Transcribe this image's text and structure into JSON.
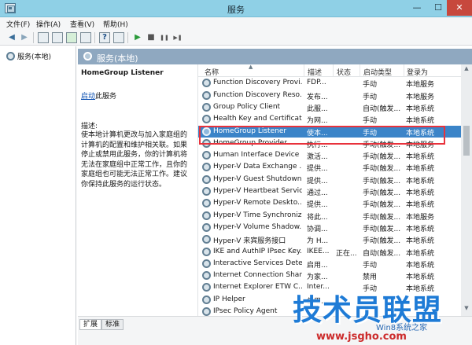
{
  "window": {
    "title": "服务",
    "min": "—",
    "max": "☐",
    "close": "✕"
  },
  "menu": [
    "文件(F)",
    "操作(A)",
    "查看(V)",
    "帮助(H)"
  ],
  "toolbar": {
    "back": "◀",
    "forward": "▶",
    "help": "?",
    "play": "▶",
    "stop": "■",
    "pause": "❚❚",
    "restart": "▶❚"
  },
  "tree": {
    "root_label": "服务(本地)"
  },
  "main": {
    "header_label": "服务(本地)"
  },
  "description": {
    "service_name": "HomeGroup Listener",
    "start_link": "启动",
    "start_suffix": "此服务",
    "heading": "描述:",
    "body": "使本地计算机更改与加入家庭组的计算机的配置和维护相关联。如果停止或禁用此服务，你的计算机将无法在家庭组中正常工作，且你的家庭组也可能无法正常工作。建议你保持此服务的运行状态。"
  },
  "columns": {
    "name": "名称",
    "desc": "描述",
    "status": "状态",
    "startup": "启动类型",
    "logon": "登录为"
  },
  "rows": [
    {
      "name": "",
      "desc": "",
      "status": "",
      "startup": "",
      "logon": ""
    },
    {
      "name": "Function Discovery Provi...",
      "desc": "FDP...",
      "status": "",
      "startup": "手动",
      "logon": "本地服务"
    },
    {
      "name": "Function Discovery Reso...",
      "desc": "发布...",
      "status": "",
      "startup": "手动",
      "logon": "本地服务"
    },
    {
      "name": "Group Policy Client",
      "desc": "此服...",
      "status": "",
      "startup": "自动(触发...",
      "logon": "本地系统"
    },
    {
      "name": "Health Key and Certificat...",
      "desc": "为网...",
      "status": "",
      "startup": "手动",
      "logon": "本地系统"
    },
    {
      "name": "HomeGroup Listener",
      "desc": "使本...",
      "status": "",
      "startup": "手动",
      "logon": "本地系统"
    },
    {
      "name": "HomeGroup Provider",
      "desc": "执行...",
      "status": "",
      "startup": "手动(触发...",
      "logon": "本地服务"
    },
    {
      "name": "Human Interface Device ...",
      "desc": "激活...",
      "status": "",
      "startup": "手动(触发...",
      "logon": "本地系统"
    },
    {
      "name": "Hyper-V Data Exchange ...",
      "desc": "提供...",
      "status": "",
      "startup": "手动(触发...",
      "logon": "本地系统"
    },
    {
      "name": "Hyper-V Guest Shutdown...",
      "desc": "提供...",
      "status": "",
      "startup": "手动(触发...",
      "logon": "本地系统"
    },
    {
      "name": "Hyper-V Heartbeat Service",
      "desc": "通过...",
      "status": "",
      "startup": "手动(触发...",
      "logon": "本地系统"
    },
    {
      "name": "Hyper-V Remote Deskto...",
      "desc": "提供...",
      "status": "",
      "startup": "手动(触发...",
      "logon": "本地系统"
    },
    {
      "name": "Hyper-V Time Synchroniz...",
      "desc": "将此...",
      "status": "",
      "startup": "手动(触发...",
      "logon": "本地服务"
    },
    {
      "name": "Hyper-V Volume Shadow...",
      "desc": "协调...",
      "status": "",
      "startup": "手动(触发...",
      "logon": "本地系统"
    },
    {
      "name": "Hyper-V 来宾服务接口",
      "desc": "为 H...",
      "status": "",
      "startup": "手动(触发...",
      "logon": "本地系统"
    },
    {
      "name": "IKE and AuthIP IPsec Key...",
      "desc": "IKEE...",
      "status": "正在...",
      "startup": "自动(触发...",
      "logon": "本地系统"
    },
    {
      "name": "Interactive Services Dete...",
      "desc": "启用...",
      "status": "",
      "startup": "手动",
      "logon": "本地系统"
    },
    {
      "name": "Internet Connection Shari...",
      "desc": "为家...",
      "status": "",
      "startup": "禁用",
      "logon": "本地系统"
    },
    {
      "name": "Internet Explorer ETW C...",
      "desc": "Inter...",
      "status": "",
      "startup": "手动",
      "logon": "本地系统"
    },
    {
      "name": "IP Helper",
      "desc": "使用...",
      "status": "",
      "startup": "",
      "logon": ""
    },
    {
      "name": "IPsec Policy Agent",
      "desc": "",
      "status": "",
      "startup": "",
      "logon": ""
    }
  ],
  "selected_row": "HomeGroup Listener",
  "highlight_color": "#e8323c",
  "tabs": [
    "扩展",
    "标准"
  ],
  "watermark": {
    "main": "技术员联盟",
    "sub": "Win8系统之家",
    "url": "www.jsgho.com"
  }
}
